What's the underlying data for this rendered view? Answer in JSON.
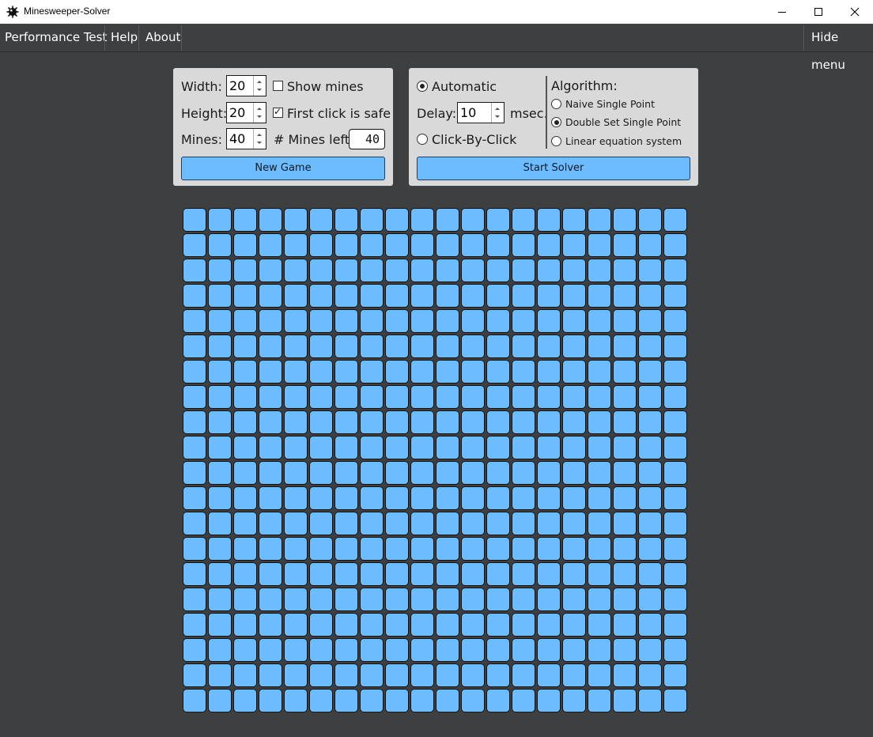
{
  "window": {
    "title": "Minesweeper-Solver",
    "controls": [
      "minimize",
      "maximize",
      "close"
    ]
  },
  "menu": {
    "items": [
      "Performance Test",
      "Help",
      "About"
    ],
    "right_item": "Hide menu"
  },
  "game_settings": {
    "width_label": "Width:",
    "width_value": "20",
    "height_label": "Height:",
    "height_value": "20",
    "mines_label": "Mines:",
    "mines_value": "40",
    "show_mines_label": "Show mines",
    "show_mines_checked": false,
    "first_click_safe_label": "First click is safe",
    "first_click_safe_checked": true,
    "mines_left_label": "# Mines left:",
    "mines_left_value": "40",
    "new_game_label": "New Game"
  },
  "solver_settings": {
    "automatic_label": "Automatic",
    "automatic_selected": true,
    "delay_label": "Delay:",
    "delay_value": "10",
    "delay_unit": "msec.",
    "click_by_click_label": "Click-By-Click",
    "click_by_click_selected": false,
    "algorithm_label": "Algorithm:",
    "algorithms": [
      {
        "label": "Naive Single Point",
        "selected": false
      },
      {
        "label": "Double Set Single Point",
        "selected": true
      },
      {
        "label": "Linear equation system",
        "selected": false
      }
    ],
    "start_solver_label": "Start Solver"
  },
  "board": {
    "columns": 20,
    "rows": 20,
    "cell_state": "covered",
    "cell_color": "#6cbcff"
  },
  "colors": {
    "background": "#3e3f41",
    "panel": "#d9d9d9",
    "button": "#6cbcff"
  }
}
